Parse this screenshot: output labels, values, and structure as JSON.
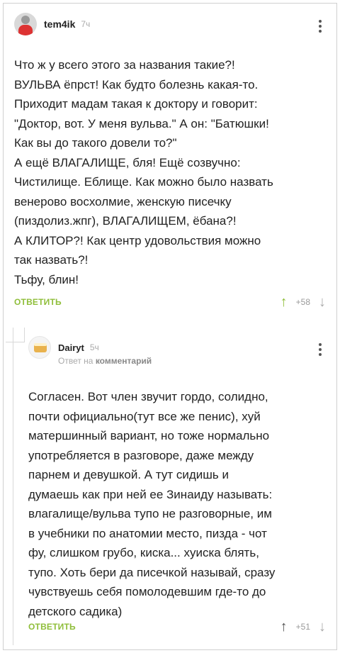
{
  "comments": [
    {
      "username": "tem4ik",
      "time": "7ч",
      "text": "Что ж у всего этого за названия такие?!\nВУЛЬВА ёпрст! Как будто болезнь какая-то.\nПриходит мадам такая к доктору и говорит:\n\"Доктор, вот. У меня вульва.\" А он: \"Батюшки!\nКак вы до такого довели то?\"\nА ещё ВЛАГАЛИЩЕ, бля! Ещё созвучно:\nЧистилище. Еблище. Как можно было назвать\nвенерово восхолмие, женскую писечку\n(пиздолиз.жпг), ВЛАГАЛИЩЕМ, ёбана?!\nА КЛИТОР?! Как центр удовольствия можно\nтак назвать?!\nТьфу, блин!",
      "reply_label": "ОТВЕТИТЬ",
      "rating": "+58"
    },
    {
      "username": "Dairyt",
      "time": "5ч",
      "reply_to_prefix": "Ответ на",
      "reply_to_target": "комментарий",
      "text": "Согласен. Вот член звучит гордо, солидно,\nпочти официально(тут все же пенис), хуй\nматершинный вариант, но тоже нормально\nупотребляется в разговоре, даже между\nпарнем и девушкой. А тут сидишь и\nдумаешь как при ней ее Зинаиду называть:\nвлагалище/вульва тупо не разговорные, им\nв учебники по анатомии место, пизда - чот\nфу, слишком грубо, киска... хуиска блять,\nтупо. Хоть бери да писечкой называй, сразу\nчувствуешь себя помолодевшим где-то до\nдетского садика)",
      "reply_label": "ОТВЕТИТЬ",
      "rating": "+51"
    }
  ],
  "icons": {
    "upvote": "↑",
    "downvote": "↓"
  },
  "colors": {
    "accent_green": "#8fbe3a",
    "muted": "#aaaaaa"
  }
}
